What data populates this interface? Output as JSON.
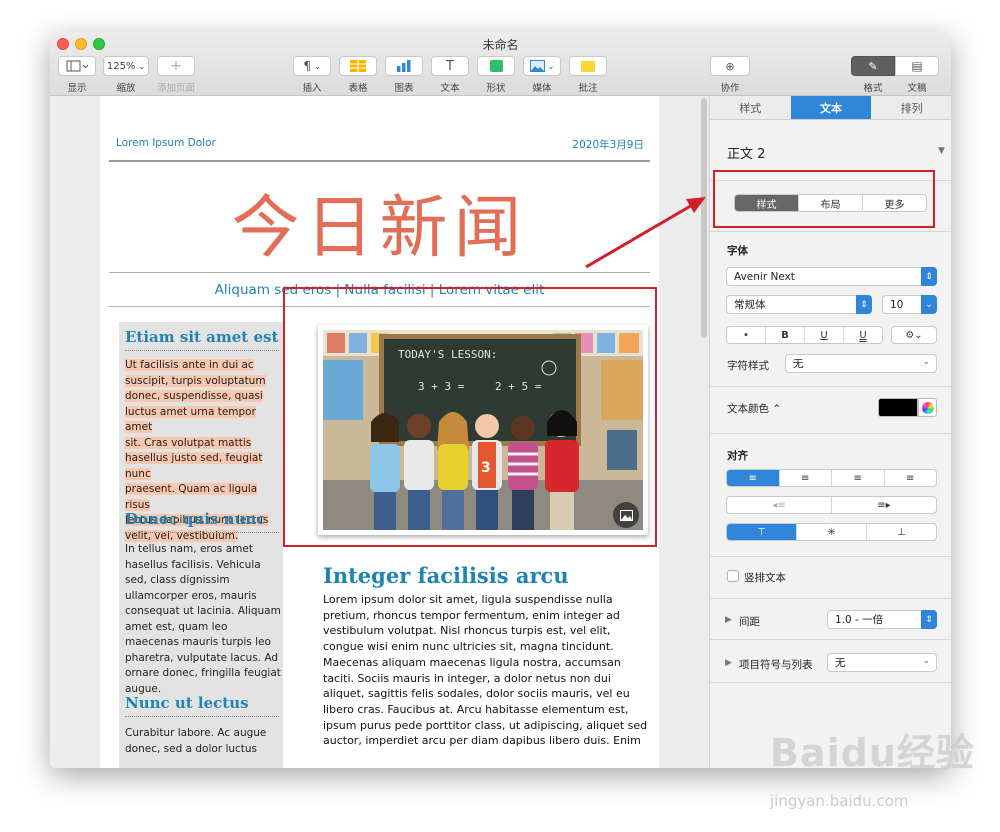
{
  "window": {
    "title": "未命名"
  },
  "toolbar": {
    "view_label": "显示",
    "zoom_value": "125%",
    "zoom_label": "缩放",
    "add_page_label": "添加页面",
    "insert_label": "插入",
    "table_label": "表格",
    "chart_label": "图表",
    "text_label": "文本",
    "shape_label": "形状",
    "media_label": "媒体",
    "comment_label": "批注",
    "collaborate_label": "协作",
    "format_label": "格式",
    "document_label": "文稿"
  },
  "document": {
    "header_left": "Lorem Ipsum Dolor",
    "header_right": "2020年3月9日",
    "masthead": "今日新闻",
    "subhead": "Aliquam sed eros | Nulla facilisi | Lorem vitae elit",
    "sidebar": {
      "heading1": "Etiam sit amet est",
      "para1_lines": [
        "Ut facilisis ante in dui ac",
        "suscipit, turpis voluptatum",
        "donec, suspendisse, quasi",
        "luctus amet urna tempor amet",
        "sit. Cras volutpat mattis",
        "hasellus justo sed, feugiat nunc",
        "praesent. Quam ac ligula risus",
        "lectus dapibus, nunc lectus",
        "velit, vel, vestibulum."
      ],
      "heading2": "Donec quis nunc",
      "para2": "In tellus nam, eros amet hasellus facilisis. Vehicula sed, class dignissim ullamcorper eros, mauris consequat ut lacinia. Aliquam amet est, quam leo maecenas mauris turpis leo pharetra, vulputate lacus. Ad ornare donec, fringilla feugiat augue.",
      "heading3": "Nunc ut lectus",
      "para3": "Curabitur labore. Ac augue donec, sed a dolor luctus"
    },
    "photo": {
      "chalkboard_text": "TODAY'S LESSON:",
      "sum1": "3 + 3 =",
      "sum2": "2 + 5 =",
      "shirt_number": "3"
    },
    "article_heading": "Integer facilisis arcu",
    "article_body": "Lorem ipsum dolor sit amet, ligula suspendisse nulla pretium, rhoncus tempor fermentum, enim integer ad vestibulum volutpat. Nisl rhoncus turpis est, vel elit, congue wisi enim nunc ultricies sit, magna tincidunt. Maecenas aliquam maecenas ligula nostra, accumsan taciti. Sociis mauris in integer, a dolor netus non dui aliquet, sagittis felis sodales, dolor sociis mauris, vel eu libero cras. Faucibus at. Arcu habitasse elementum est, ipsum purus pede porttitor class, ut adipiscing, aliquet sed auctor, imperdiet arcu per diam dapibus libero duis. Enim"
  },
  "inspector": {
    "tabs": [
      "样式",
      "文本",
      "排列"
    ],
    "active_tab": "文本",
    "paragraph_style": "正文 2",
    "sub_tabs": [
      "样式",
      "布局",
      "更多"
    ],
    "font_label": "字体",
    "font_name": "Avenir Next",
    "font_weight": "常规体",
    "font_size": "10",
    "format_buttons": [
      "•",
      "B",
      "U",
      "U"
    ],
    "char_style_label": "字符样式",
    "char_style_value": "无",
    "text_color_label": "文本颜色",
    "text_color_stepper": "⌃",
    "align_label": "对齐",
    "vertical_text_label": "竖排文本",
    "spacing_label": "间距",
    "spacing_value": "1.0 - 一倍",
    "bullets_label": "项目符号与列表",
    "bullets_value": "无"
  },
  "colors": {
    "accent": "#2f86d8",
    "heading": "#1f83b3",
    "masthead": "#e26e58",
    "highlight": "#f8c7ad",
    "annotation": "#d0202a"
  },
  "watermark": {
    "brand": "Baidu经验",
    "url": "jingyan.baidu.com"
  }
}
